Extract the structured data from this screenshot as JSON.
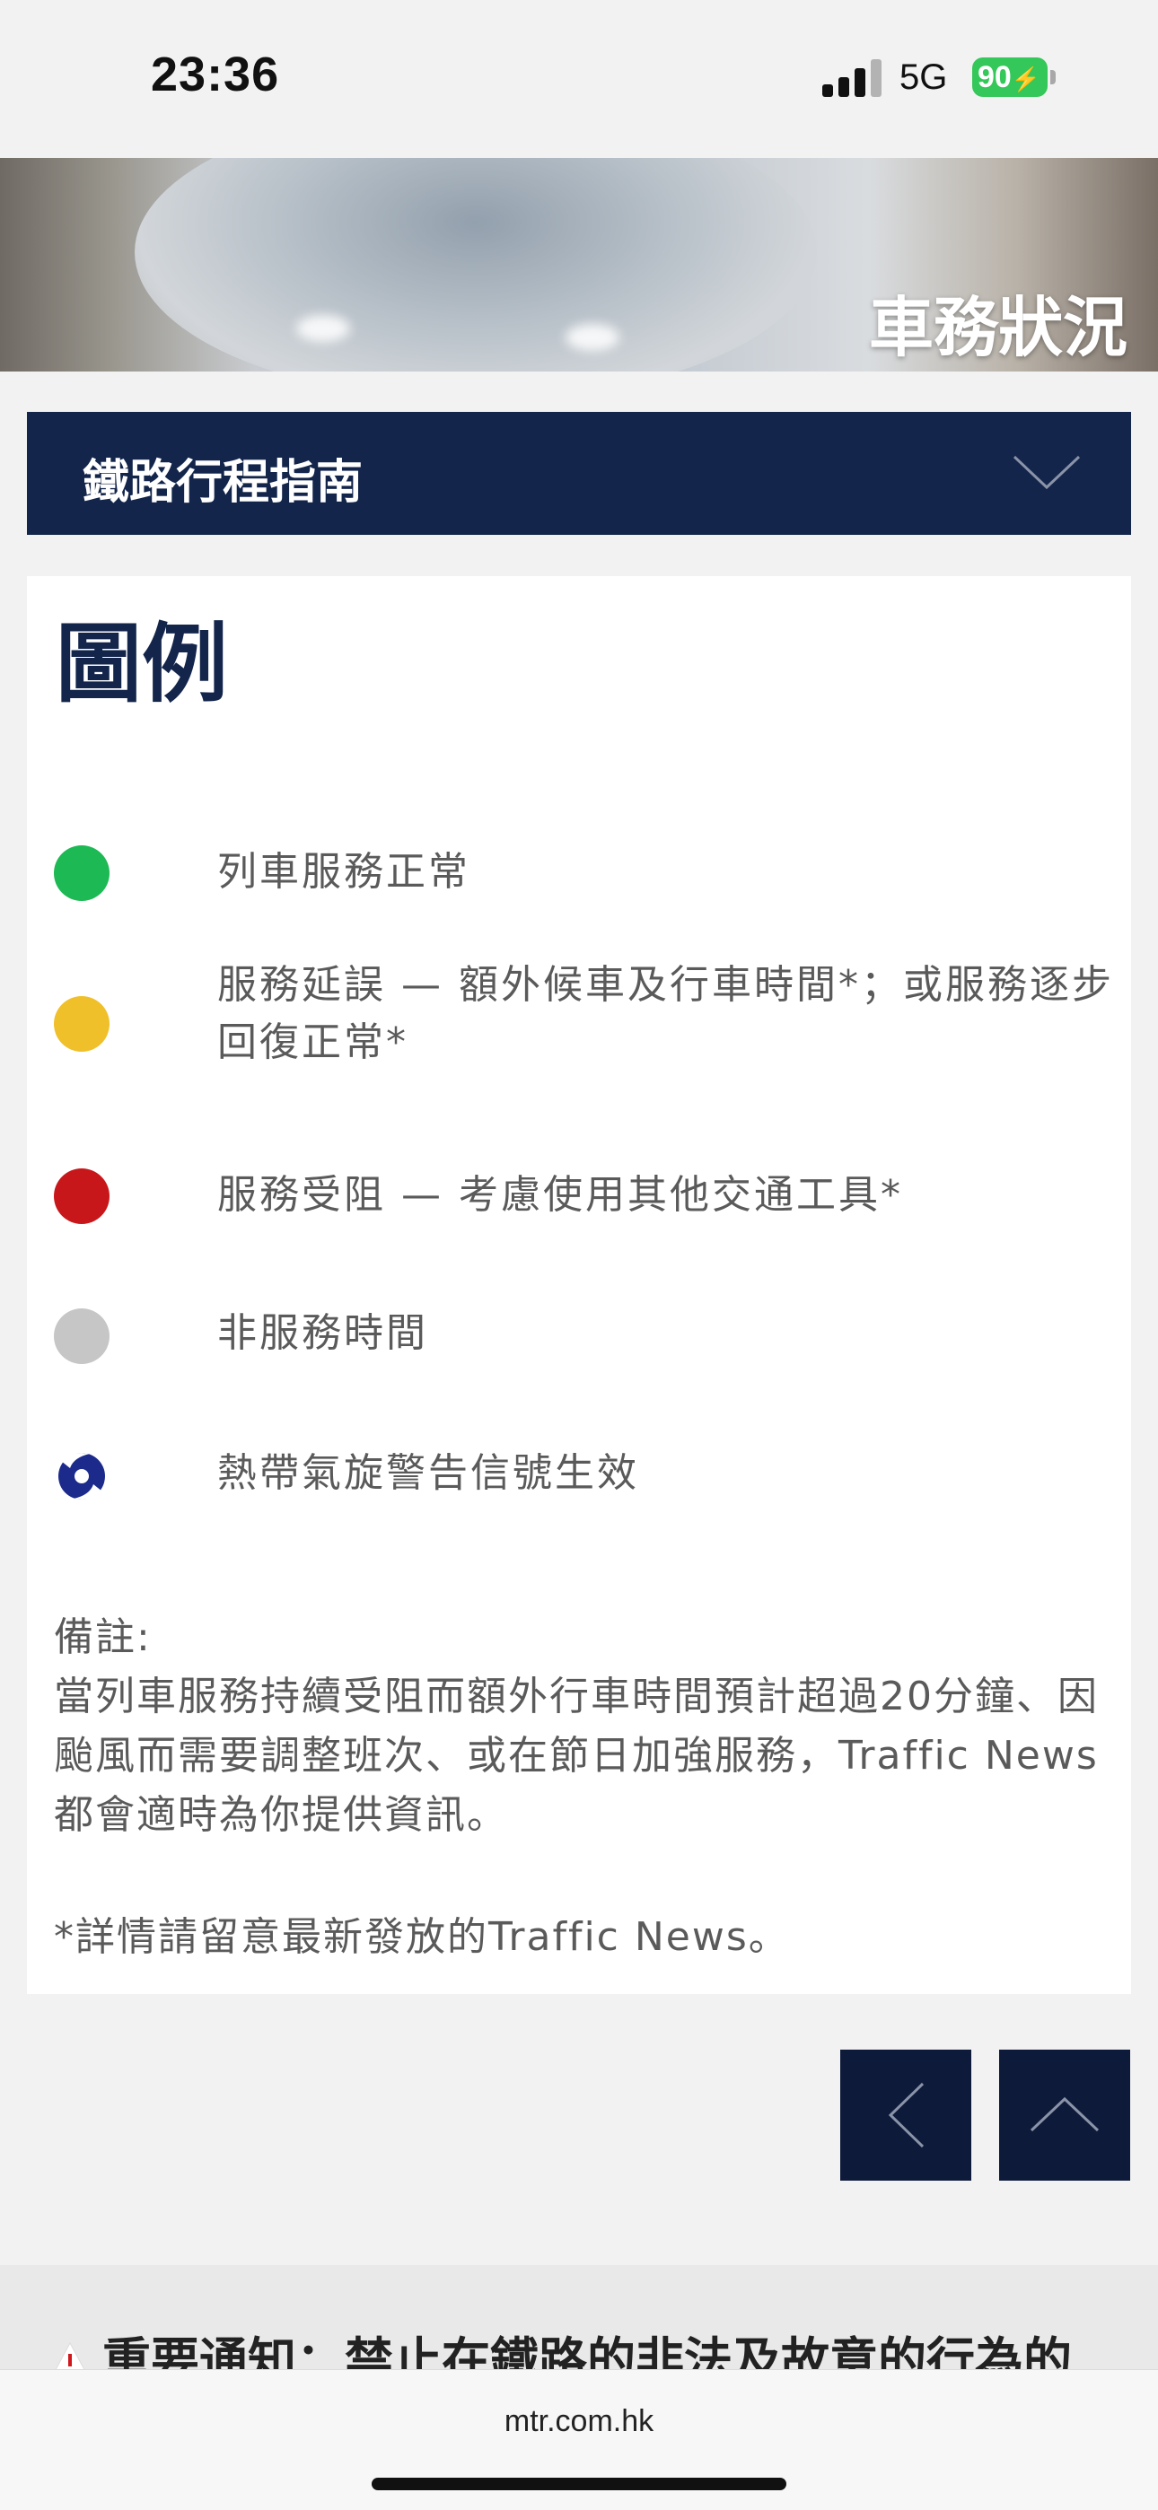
{
  "status_bar": {
    "time": "23:36",
    "network": "5G",
    "battery": "90"
  },
  "banner": {
    "title": "車務狀況"
  },
  "dropdown": {
    "label": "鐵路行程指南"
  },
  "legend": {
    "title": "圖例",
    "items": [
      {
        "color": "#1db954",
        "text": "列車服務正常"
      },
      {
        "color": "#f0c02a",
        "text": "服務延誤 — 額外候車及行車時間*；或服務逐步回復正常*"
      },
      {
        "color": "#c8171a",
        "text": "服務受阻 — 考慮使用其他交通工具*"
      },
      {
        "color": "#c6c6c6",
        "text": "非服務時間"
      },
      {
        "icon": "typhoon-icon",
        "color": "#1c2a8c",
        "text": "熱帶氣旋警告信號生效"
      }
    ],
    "notes_label": "備註:",
    "notes_text": "當列車服務持續受阻而額外行車時間預計超過20分鐘、因颱風而需要調整班次、或在節日加強服務，Traffic News都會適時為你提供資訊。",
    "footnote": "*詳情請留意最新發放的Traffic News。"
  },
  "nav": {
    "back_icon": "chevron-left-icon",
    "top_icon": "chevron-up-icon"
  },
  "notice": {
    "icon": "warning-icon",
    "text": "重要通知：禁止在鐵路的非法及故意的行為的"
  },
  "browser": {
    "url": "mtr.com.hk"
  }
}
